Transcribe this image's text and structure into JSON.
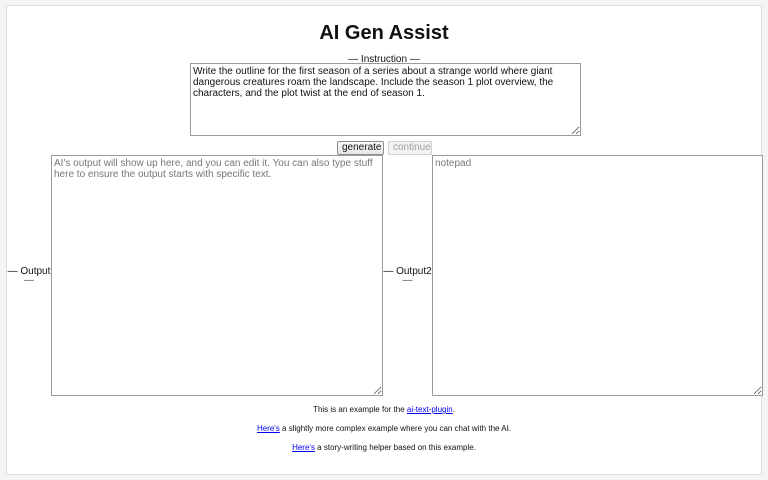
{
  "app": {
    "title": "AI Gen Assist"
  },
  "instruction": {
    "label": "— Instruction —",
    "value": "Write the outline for the first season of a series about a strange world where giant dangerous creatures roam the landscape. Include the season 1 plot overview, the characters, and the plot twist at the end of season 1."
  },
  "buttons": {
    "generate_label": "generate",
    "continue_label": "continue"
  },
  "output": {
    "label": "— Output",
    "dash": "—",
    "placeholder": "AI's output will show up here, and you can edit it. You can also type stuff here to ensure the output starts with specific text.",
    "value": ""
  },
  "output2": {
    "label": "— Output2",
    "dash": "—",
    "placeholder": "notepad",
    "value": ""
  },
  "footer": {
    "line1_prefix": "This is an example for the ",
    "line1_link": "ai-text-plugin",
    "line1_suffix": ".",
    "line2_link": "Here's",
    "line2_suffix": " a slightly more complex example where you can chat with the AI.",
    "line3_link": "Here's",
    "line3_suffix": " a story-writing helper based on this example."
  }
}
